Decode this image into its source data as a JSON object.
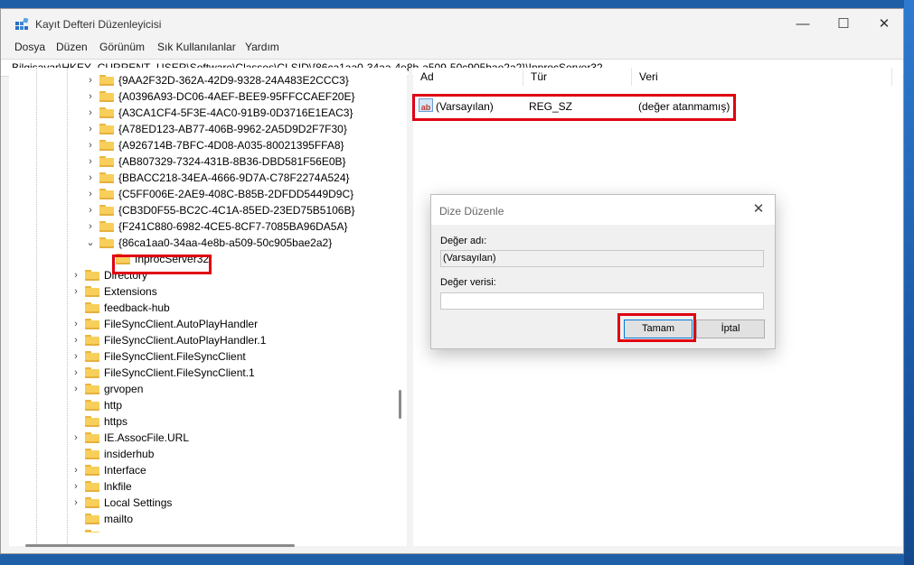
{
  "window": {
    "title": "Kayıt Defteri Düzenleyicisi",
    "caption_minimize": "—",
    "caption_maximize": "☐",
    "caption_close": "✕"
  },
  "menu": [
    "Dosya",
    "Düzen",
    "Görünüm",
    "Sık Kullanılanlar",
    "Yardım"
  ],
  "address": "Bilgisayar\\HKEY_CURRENT_USER\\Software\\Classes\\CLSID\\{86ca1aa0-34aa-4e8b-a509-50c905bae2a2}\\InprocServer32",
  "tree": {
    "clsid_children": [
      "{9AA2F32D-362A-42D9-9328-24A483E2CCC3}",
      "{A0396A93-DC06-4AEF-BEE9-95FFCCAEF20E}",
      "{A3CA1CF4-5F3E-4AC0-91B9-0D3716E1EAC3}",
      "{A78ED123-AB77-406B-9962-2A5D9D2F7F30}",
      "{A926714B-7BFC-4D08-A035-80021395FFA8}",
      "{AB807329-7324-431B-8B36-DBD581F56E0B}",
      "{BBACC218-34EA-4666-9D7A-C78F2274A524}",
      "{C5FF006E-2AE9-408C-B85B-2DFDD5449D9C}",
      "{CB3D0F55-BC2C-4C1A-85ED-23ED75B5106B}",
      "{F241C880-6982-4CE5-8CF7-7085BA96DA5A}",
      "{86ca1aa0-34aa-4e8b-a509-50c905bae2a2}"
    ],
    "selected_child": "InprocServer32",
    "classes_children": [
      "Directory",
      "Extensions",
      "feedback-hub",
      "FileSyncClient.AutoPlayHandler",
      "FileSyncClient.AutoPlayHandler.1",
      "FileSyncClient.FileSyncClient",
      "FileSyncClient.FileSyncClient.1",
      "grvopen",
      "http",
      "https",
      "IE.AssocFile.URL",
      "insiderhub",
      "Interface",
      "lnkfile",
      "Local Settings",
      "mailto"
    ]
  },
  "values": {
    "columns": [
      "Ad",
      "Tür",
      "Veri"
    ],
    "rows": [
      {
        "name": "(Varsayılan)",
        "type": "REG_SZ",
        "data": "(değer atanmamış)",
        "icon": "ab"
      }
    ]
  },
  "dialog": {
    "title": "Dize Düzenle",
    "name_label": "Değer adı:",
    "name_value": "(Varsayılan)",
    "data_label": "Değer verisi:",
    "data_value": "",
    "ok_label": "Tamam",
    "cancel_label": "İptal"
  },
  "colors": {
    "highlight_red": "#e00012",
    "folder_yellow": "#f7cf5a"
  }
}
